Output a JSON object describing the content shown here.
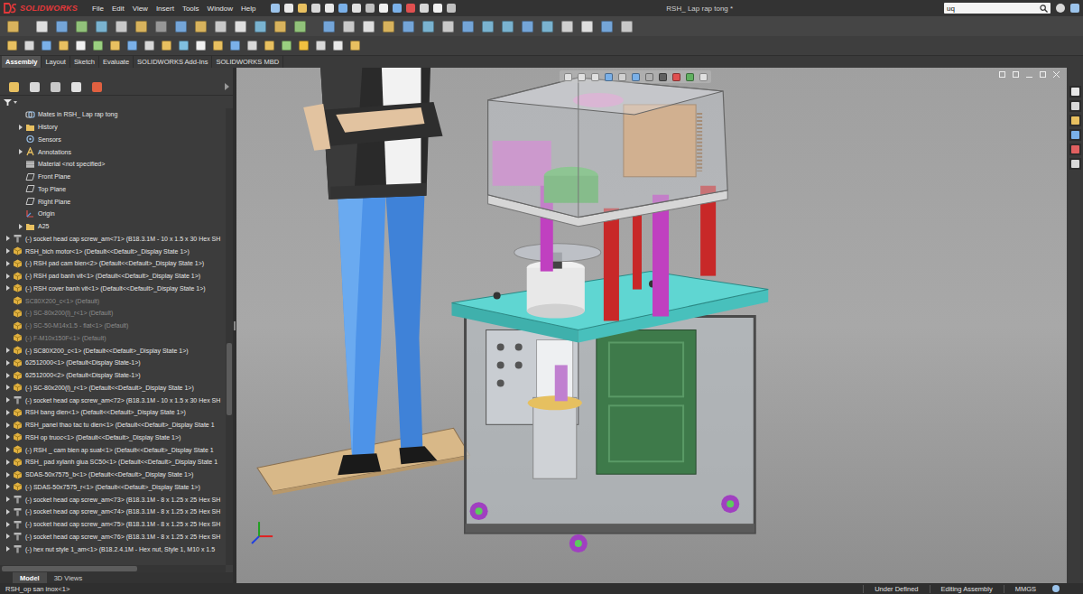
{
  "window": {
    "title": "RSH_ Lap rap tong *",
    "logo": "SOLIDWORKS"
  },
  "menu": [
    "File",
    "Edit",
    "View",
    "Insert",
    "Tools",
    "Window",
    "Help"
  ],
  "search": {
    "value": "uq"
  },
  "command_tabs": [
    {
      "label": "Assembly",
      "selected": true
    },
    {
      "label": "Layout",
      "selected": false
    },
    {
      "label": "Sketch",
      "selected": false
    },
    {
      "label": "Evaluate",
      "selected": false
    },
    {
      "label": "SOLIDWORKS Add-Ins",
      "selected": false
    },
    {
      "label": "SOLIDWORKS MBD",
      "selected": false
    }
  ],
  "feature_tree": {
    "items": [
      {
        "label": "Mates in RSH_ Lap rap tong",
        "kind": "mates",
        "depth": 1,
        "expandable": false,
        "dimmed": false
      },
      {
        "label": "History",
        "kind": "folder",
        "depth": 1,
        "expandable": true,
        "dimmed": false
      },
      {
        "label": "Sensors",
        "kind": "sensor",
        "depth": 1,
        "expandable": false,
        "dimmed": false
      },
      {
        "label": "Annotations",
        "kind": "annotation",
        "depth": 1,
        "expandable": true,
        "dimmed": false
      },
      {
        "label": "Material <not specified>",
        "kind": "material",
        "depth": 1,
        "expandable": false,
        "dimmed": false
      },
      {
        "label": "Front Plane",
        "kind": "plane",
        "depth": 1,
        "expandable": false,
        "dimmed": false
      },
      {
        "label": "Top Plane",
        "kind": "plane",
        "depth": 1,
        "expandable": false,
        "dimmed": false
      },
      {
        "label": "Right Plane",
        "kind": "plane",
        "depth": 1,
        "expandable": false,
        "dimmed": false
      },
      {
        "label": "Origin",
        "kind": "origin",
        "depth": 1,
        "expandable": false,
        "dimmed": false
      },
      {
        "label": "A25",
        "kind": "folder",
        "depth": 1,
        "expandable": true,
        "dimmed": false
      },
      {
        "label": "(-) socket head cap screw_am<71> (B18.3.1M - 10 x 1.5 x 30 Hex SH",
        "kind": "screw",
        "depth": 0,
        "expandable": true,
        "dimmed": false
      },
      {
        "label": "RSH_bich motor<1> (Default<<Default>_Display State 1>)",
        "kind": "part",
        "depth": 0,
        "expandable": true,
        "dimmed": false
      },
      {
        "label": "(-) RSH pad cam bien<2> (Default<<Default>_Display State 1>)",
        "kind": "part",
        "depth": 0,
        "expandable": true,
        "dimmed": false
      },
      {
        "label": "(-) RSH pad banh vit<1> (Default<<Default>_Display State 1>)",
        "kind": "part",
        "depth": 0,
        "expandable": true,
        "dimmed": false
      },
      {
        "label": "(-) RSH cover banh vit<1> (Default<<Default>_Display State 1>)",
        "kind": "part",
        "depth": 0,
        "expandable": true,
        "dimmed": false
      },
      {
        "label": "SC80X200_c<1> (Default)",
        "kind": "part",
        "depth": 0,
        "expandable": false,
        "dimmed": true
      },
      {
        "label": "(-) SC-80x200(l)_r<1> (Default)",
        "kind": "part",
        "depth": 0,
        "expandable": false,
        "dimmed": true
      },
      {
        "label": "(-) SC-50-M14x1.5 - flat<1> (Default)",
        "kind": "part",
        "depth": 0,
        "expandable": false,
        "dimmed": true
      },
      {
        "label": "(-) F-M10x150F<1> (Default)",
        "kind": "part",
        "depth": 0,
        "expandable": false,
        "dimmed": true
      },
      {
        "label": "(-) SC80X200_c<1> (Default<<Default>_Display State 1>)",
        "kind": "part",
        "depth": 0,
        "expandable": true,
        "dimmed": false
      },
      {
        "label": "62512000<1> (Default<Display State-1>)",
        "kind": "part",
        "depth": 0,
        "expandable": true,
        "dimmed": false
      },
      {
        "label": "62512000<2> (Default<Display State-1>)",
        "kind": "part",
        "depth": 0,
        "expandable": true,
        "dimmed": false
      },
      {
        "label": "(-) SC-80x200(l)_r<1> (Default<<Default>_Display State 1>)",
        "kind": "part",
        "depth": 0,
        "expandable": true,
        "dimmed": false
      },
      {
        "label": "(-) socket head cap screw_am<72> (B18.3.1M - 10 x 1.5 x 30 Hex SH",
        "kind": "screw",
        "depth": 0,
        "expandable": true,
        "dimmed": false
      },
      {
        "label": "RSH bang dien<1> (Default<<Default>_Display State 1>)",
        "kind": "part",
        "depth": 0,
        "expandable": true,
        "dimmed": false
      },
      {
        "label": "RSH_panel thao tac tu dien<1> (Default<<Default>_Display State 1",
        "kind": "part",
        "depth": 0,
        "expandable": true,
        "dimmed": false
      },
      {
        "label": "RSH op truoc<1> (Default<<Default>_Display State 1>)",
        "kind": "part",
        "depth": 0,
        "expandable": true,
        "dimmed": false
      },
      {
        "label": "(-) RSH _ cam bien ap suat<1> (Default<<Default>_Display State 1",
        "kind": "part",
        "depth": 0,
        "expandable": true,
        "dimmed": false
      },
      {
        "label": "RSH_ pad xylanh giua SC50<1> (Default<<Default>_Display State 1",
        "kind": "part",
        "depth": 0,
        "expandable": true,
        "dimmed": false
      },
      {
        "label": "SDAS-50x7575_b<1> (Default<<Default>_Display State 1>)",
        "kind": "part",
        "depth": 0,
        "expandable": true,
        "dimmed": false
      },
      {
        "label": "(-) SDAS-50x7575_r<1> (Default<<Default>_Display State 1>)",
        "kind": "part",
        "depth": 0,
        "expandable": true,
        "dimmed": false
      },
      {
        "label": "(-) socket head cap screw_am<73> (B18.3.1M - 8 x 1.25 x 25 Hex SH",
        "kind": "screw",
        "depth": 0,
        "expandable": true,
        "dimmed": false
      },
      {
        "label": "(-) socket head cap screw_am<74> (B18.3.1M - 8 x 1.25 x 25 Hex SH",
        "kind": "screw",
        "depth": 0,
        "expandable": true,
        "dimmed": false
      },
      {
        "label": "(-) socket head cap screw_am<75> (B18.3.1M - 8 x 1.25 x 25 Hex SH",
        "kind": "screw",
        "depth": 0,
        "expandable": true,
        "dimmed": false
      },
      {
        "label": "(-) socket head cap screw_am<76> (B18.3.1M - 8 x 1.25 x 25 Hex SH",
        "kind": "screw",
        "depth": 0,
        "expandable": true,
        "dimmed": false
      },
      {
        "label": "(-) hex nut style 1_am<1> (B18.2.4.1M - Hex nut, Style 1, M10 x 1.5",
        "kind": "screw",
        "depth": 0,
        "expandable": true,
        "dimmed": false
      }
    ]
  },
  "panel_tabs": [
    {
      "label": "Model",
      "selected": true
    },
    {
      "label": "3D Views",
      "selected": false
    }
  ],
  "status_bar": {
    "selection": "RSH_op san inox<1>",
    "items": [
      "Under Defined",
      "Editing Assembly",
      "MMGS"
    ]
  }
}
